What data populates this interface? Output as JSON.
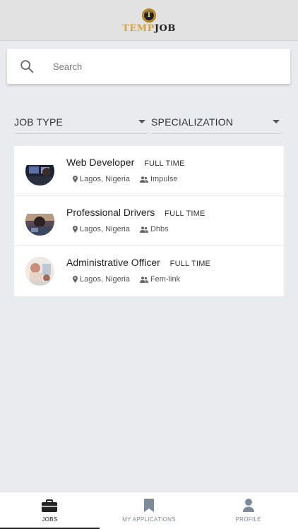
{
  "header": {
    "logo_letter": "T",
    "logo_text_a": "TEMP",
    "logo_text_b": "JOB"
  },
  "search": {
    "placeholder": "Search"
  },
  "filters": {
    "job_type_label": "JOB TYPE",
    "specialization_label": "SPECIALIZATION"
  },
  "jobs": [
    {
      "title": "Web Developer",
      "type": "FULL TIME",
      "location": "Lagos, Nigeria",
      "company": "Impulse"
    },
    {
      "title": "Professional Drivers",
      "type": "FULL TIME",
      "location": "Lagos, Nigeria",
      "company": "Dhbs"
    },
    {
      "title": "Administrative Officer",
      "type": "FULL TIME",
      "location": "Lagos, Nigeria",
      "company": "Fem-link"
    }
  ],
  "bottom_nav": {
    "items": [
      {
        "label": "JOBS",
        "icon": "briefcase-icon",
        "active": true
      },
      {
        "label": "MY APPLICATIONS",
        "icon": "bookmark-icon",
        "active": false
      },
      {
        "label": "PROFILE",
        "icon": "user-icon",
        "active": false
      }
    ]
  },
  "colors": {
    "background": "#e9ecef",
    "header": "#e2e2e2",
    "brand_gold": "#d9a23a",
    "nav_inactive": "#7d8a99"
  }
}
